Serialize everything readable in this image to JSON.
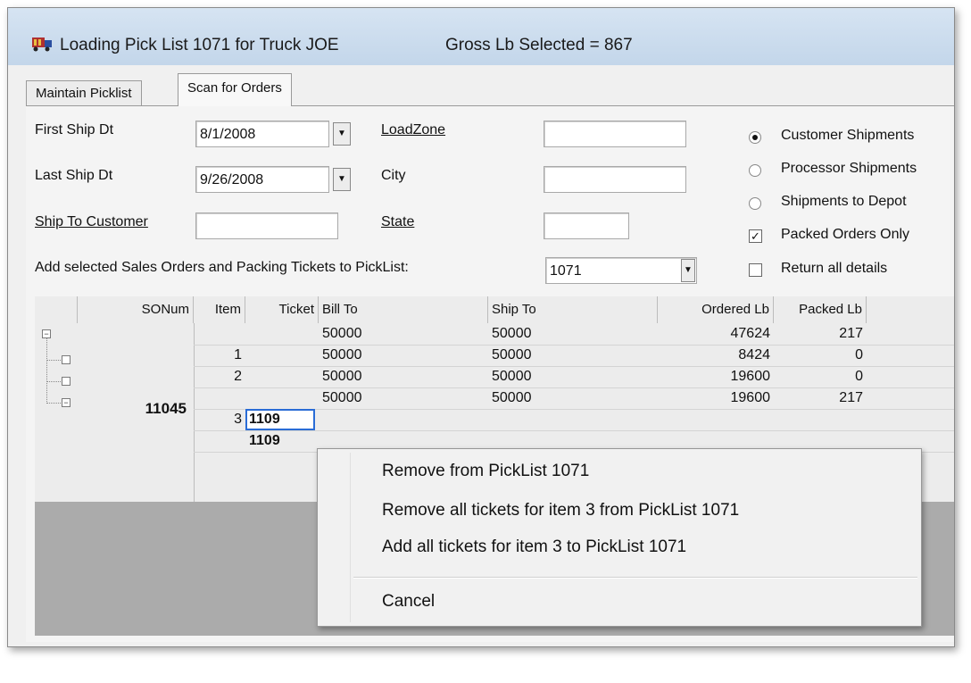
{
  "window": {
    "title": "Loading Pick List 1071 for Truck JOE",
    "gross": "Gross Lb Selected = 867"
  },
  "tabs": [
    {
      "label": "Maintain Picklist"
    },
    {
      "label": "Scan for Orders"
    }
  ],
  "form": {
    "first_ship_label": "First Ship Dt",
    "first_ship_value": "8/1/2008",
    "last_ship_label": "Last Ship Dt",
    "last_ship_value": "9/26/2008",
    "ship_to_customer_label": "Ship To Customer",
    "ship_to_customer_value": "",
    "loadzone_label": "LoadZone",
    "loadzone_value": "",
    "city_label": "City",
    "city_value": "",
    "state_label": "State",
    "state_value": "",
    "add_selected_label": "Add selected Sales Orders and Packing Tickets to PickList:",
    "picklist_value": "1071",
    "radio_customer": "Customer Shipments",
    "radio_processor": "Processor Shipments",
    "radio_depot": "Shipments to Depot",
    "check_packed": "Packed Orders Only",
    "check_return": "Return all details"
  },
  "grid": {
    "columns": [
      "SONum",
      "Item",
      "Ticket",
      "Bill To",
      "Ship To",
      "Ordered Lb",
      "Packed Lb"
    ],
    "sonum": "11045",
    "rows": [
      {
        "item": "",
        "ticket": "",
        "bill_to": "50000",
        "ship_to": "50000",
        "ordered": "47624",
        "packed": "217"
      },
      {
        "item": "1",
        "ticket": "",
        "bill_to": "50000",
        "ship_to": "50000",
        "ordered": "8424",
        "packed": "0"
      },
      {
        "item": "2",
        "ticket": "",
        "bill_to": "50000",
        "ship_to": "50000",
        "ordered": "19600",
        "packed": "0"
      },
      {
        "item": "",
        "ticket": "",
        "bill_to": "50000",
        "ship_to": "50000",
        "ordered": "19600",
        "packed": "217"
      },
      {
        "item": "3",
        "ticket": "1109",
        "bill_to": "",
        "ship_to": "",
        "ordered": "",
        "packed": ""
      },
      {
        "item": "",
        "ticket": "1109",
        "bill_to": "",
        "ship_to": "",
        "ordered": "",
        "packed": ""
      }
    ]
  },
  "context_menu": {
    "items": [
      "Remove from PickList 1071",
      "Remove all tickets for item 3 from PickList 1071",
      "Add all tickets for item 3 to PickList 1071",
      "Cancel"
    ]
  }
}
